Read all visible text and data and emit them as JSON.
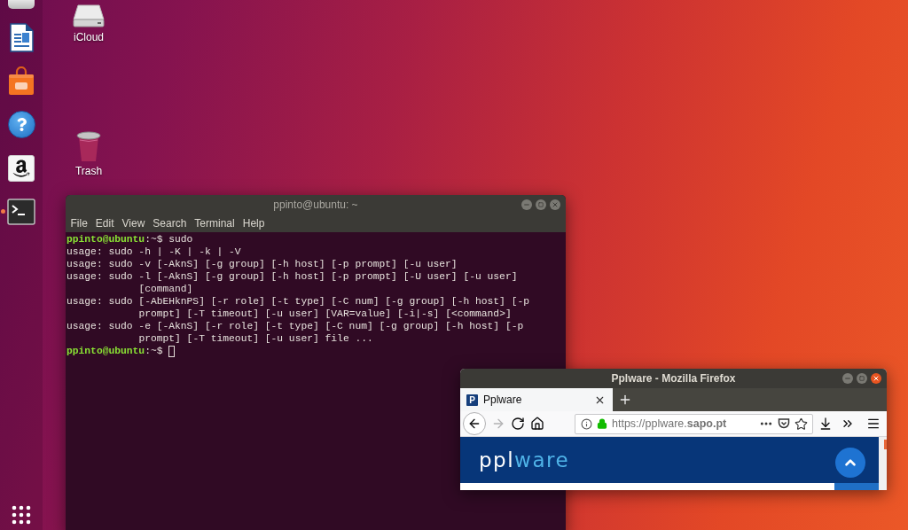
{
  "dock": {
    "items": [
      {
        "kind": "partial",
        "running": false
      },
      {
        "kind": "writer",
        "running": false
      },
      {
        "kind": "software",
        "running": false
      },
      {
        "kind": "help",
        "running": false
      },
      {
        "kind": "amazon",
        "running": false
      },
      {
        "kind": "terminal",
        "running": true
      }
    ]
  },
  "desktop_icons": [
    {
      "kind": "drive",
      "label": "iCloud"
    },
    {
      "kind": "trash",
      "label": "Trash"
    }
  ],
  "terminal": {
    "title": "ppinto@ubuntu: ~",
    "focused": false,
    "menu": [
      "File",
      "Edit",
      "View",
      "Search",
      "Terminal",
      "Help"
    ],
    "lines": [
      {
        "kind": "prompt",
        "user_host": "ppinto@ubuntu",
        "path": ":~$",
        "command": "sudo",
        "cursor": false
      },
      {
        "kind": "output",
        "text": "usage: sudo -h | -K | -k | -V"
      },
      {
        "kind": "output",
        "text": "usage: sudo -v [-AknS] [-g group] [-h host] [-p prompt] [-u user]"
      },
      {
        "kind": "output",
        "text": "usage: sudo -l [-AknS] [-g group] [-h host] [-p prompt] [-U user] [-u user]"
      },
      {
        "kind": "wrap",
        "text": "[command]"
      },
      {
        "kind": "output",
        "text": "usage: sudo [-AbEHknPS] [-r role] [-t type] [-C num] [-g group] [-h host] [-p"
      },
      {
        "kind": "wrap",
        "text": "prompt] [-T timeout] [-u user] [VAR=value] [-i|-s] [<command>]"
      },
      {
        "kind": "output",
        "text": "usage: sudo -e [-AknS] [-r role] [-t type] [-C num] [-g group] [-h host] [-p"
      },
      {
        "kind": "wrap",
        "text": "prompt] [-T timeout] [-u user] file ..."
      },
      {
        "kind": "prompt",
        "user_host": "ppinto@ubuntu",
        "path": ":~$",
        "cursor": true
      }
    ]
  },
  "browser": {
    "title": "Pplware - Mozilla Firefox",
    "focused": true,
    "tabs": [
      {
        "favicon": "P",
        "label": "Pplware",
        "selected": true
      }
    ],
    "nav": [
      {
        "kind": "back",
        "disabled": false
      },
      {
        "kind": "forward",
        "disabled": true
      },
      {
        "kind": "reload",
        "disabled": false
      },
      {
        "kind": "home",
        "disabled": false
      }
    ],
    "url": "https://pplware.**sapo.pt**",
    "page": {
      "logo": {
        "primary": "ppl",
        "accent": "ware"
      }
    }
  }
}
